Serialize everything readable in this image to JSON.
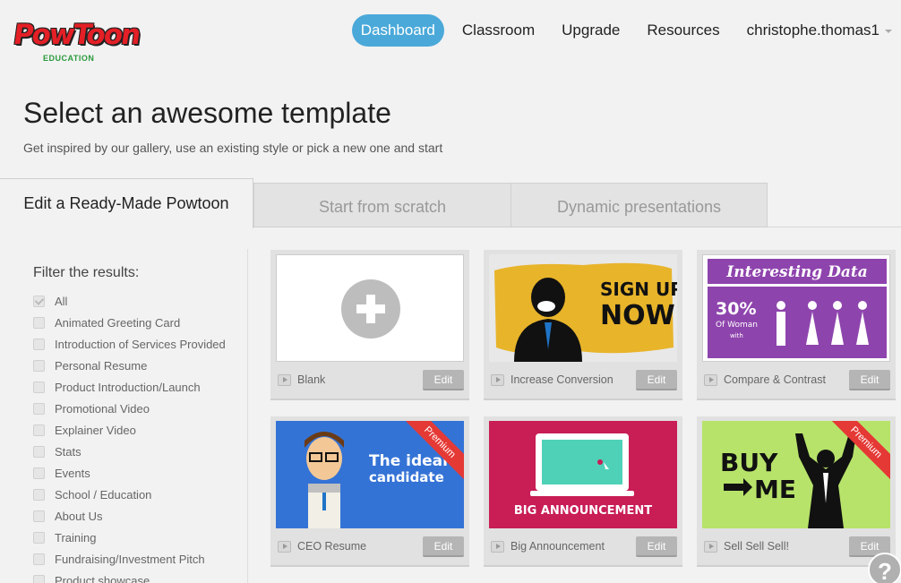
{
  "header": {
    "logo_text": "PowToon",
    "logo_sub": "EDUCATION",
    "nav": [
      {
        "label": "Dashboard",
        "active": true
      },
      {
        "label": "Classroom"
      },
      {
        "label": "Upgrade"
      },
      {
        "label": "Resources"
      },
      {
        "label": "christophe.thomas1"
      }
    ]
  },
  "page": {
    "title": "Select an awesome template",
    "subtitle": "Get inspired by our gallery, use an existing style or pick a new one and start"
  },
  "tabs": [
    {
      "label": "Edit a Ready-Made Powtoon",
      "active": true
    },
    {
      "label": "Start from scratch"
    },
    {
      "label": "Dynamic presentations"
    }
  ],
  "filter": {
    "title": "Filter the results:",
    "items": [
      {
        "label": "All",
        "checked": true
      },
      {
        "label": "Animated Greeting Card"
      },
      {
        "label": "Introduction of Services Provided"
      },
      {
        "label": "Personal Resume"
      },
      {
        "label": "Product Introduction/Launch"
      },
      {
        "label": "Promotional Video"
      },
      {
        "label": "Explainer Video"
      },
      {
        "label": "Stats"
      },
      {
        "label": "Events"
      },
      {
        "label": "School / Education"
      },
      {
        "label": "About Us"
      },
      {
        "label": "Training"
      },
      {
        "label": "Fundraising/Investment Pitch"
      },
      {
        "label": "Product showcase"
      }
    ]
  },
  "templates": [
    {
      "name": "Blank",
      "edit_label": "Edit"
    },
    {
      "name": "Increase Conversion",
      "edit_label": "Edit",
      "thumb_text_1": "SIGN UP",
      "thumb_text_2": "NOW!"
    },
    {
      "name": "Compare & Contrast",
      "edit_label": "Edit",
      "thumb_title": "Interesting Data",
      "thumb_stat": "30%",
      "thumb_stat_sub": "Of Woman",
      "thumb_with": "with"
    },
    {
      "name": "CEO Resume",
      "edit_label": "Edit",
      "premium": "Premium",
      "thumb_text_1": "The ideal",
      "thumb_text_2": "candidate"
    },
    {
      "name": "Big Announcement",
      "edit_label": "Edit",
      "thumb_text_1": "BIG ANNOUNCEMENT"
    },
    {
      "name": "Sell Sell Sell!",
      "edit_label": "Edit",
      "premium": "Premium",
      "thumb_text_1": "BUY",
      "thumb_text_2": "ME"
    }
  ],
  "help_label": "?"
}
